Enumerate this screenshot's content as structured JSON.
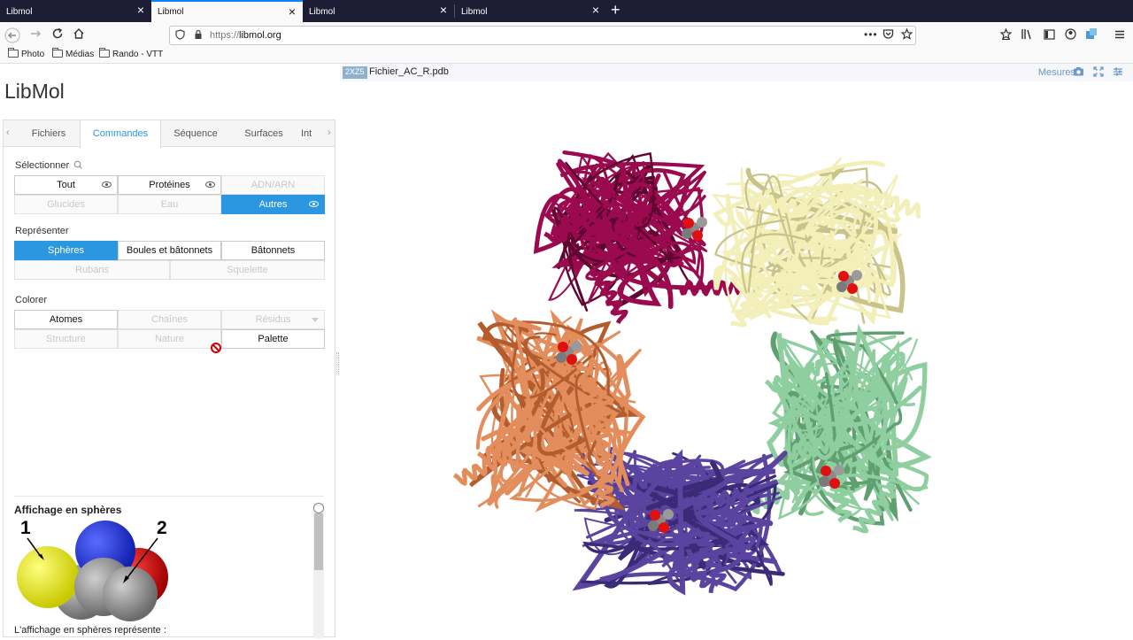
{
  "browser": {
    "tabs": [
      {
        "title": "Libmol",
        "active": false
      },
      {
        "title": "Libmol",
        "active": true
      },
      {
        "title": "Libmol",
        "active": false
      },
      {
        "title": "Libmol",
        "active": false
      }
    ],
    "url_protocol": "https://",
    "url_host": "libmol.org",
    "bookmarks": [
      "Photo",
      "Médias",
      "Rando - VTT"
    ]
  },
  "app": {
    "title": "LibMol",
    "tabs": [
      "Fichiers",
      "Commandes",
      "Séquence",
      "Surfaces",
      "Int"
    ],
    "active_tab": "Commandes",
    "select": {
      "label": "Sélectionner",
      "row1": [
        "Tout",
        "Protéines",
        "ADN/ARN"
      ],
      "row2": [
        "Glucides",
        "Eau",
        "Autres"
      ]
    },
    "represent": {
      "label": "Représenter",
      "row1": [
        "Sphères",
        "Boules et bâtonnets",
        "Bâtonnets"
      ],
      "row2": [
        "Rubans",
        "Squelette"
      ]
    },
    "color": {
      "label": "Colorer",
      "row1": [
        "Atomes",
        "Chaînes",
        "Résidus"
      ],
      "row2": [
        "Structure",
        "Nature",
        "Palette"
      ]
    },
    "help": {
      "title": "Affichage en sphères",
      "label_1": "1",
      "label_2": "2",
      "text": "L'affichage en sphères représente :"
    }
  },
  "viewer": {
    "pdb_id": "2XZ5",
    "file": "Fichier_AC_R.pdb",
    "measures_label": "Mesures",
    "chain_colors": {
      "A": "#9b0a4f",
      "B": "#f3efb8",
      "C": "#8fcf9f",
      "D": "#5a44a0",
      "E": "#e48d5c"
    },
    "accent": "#2a97e0"
  }
}
